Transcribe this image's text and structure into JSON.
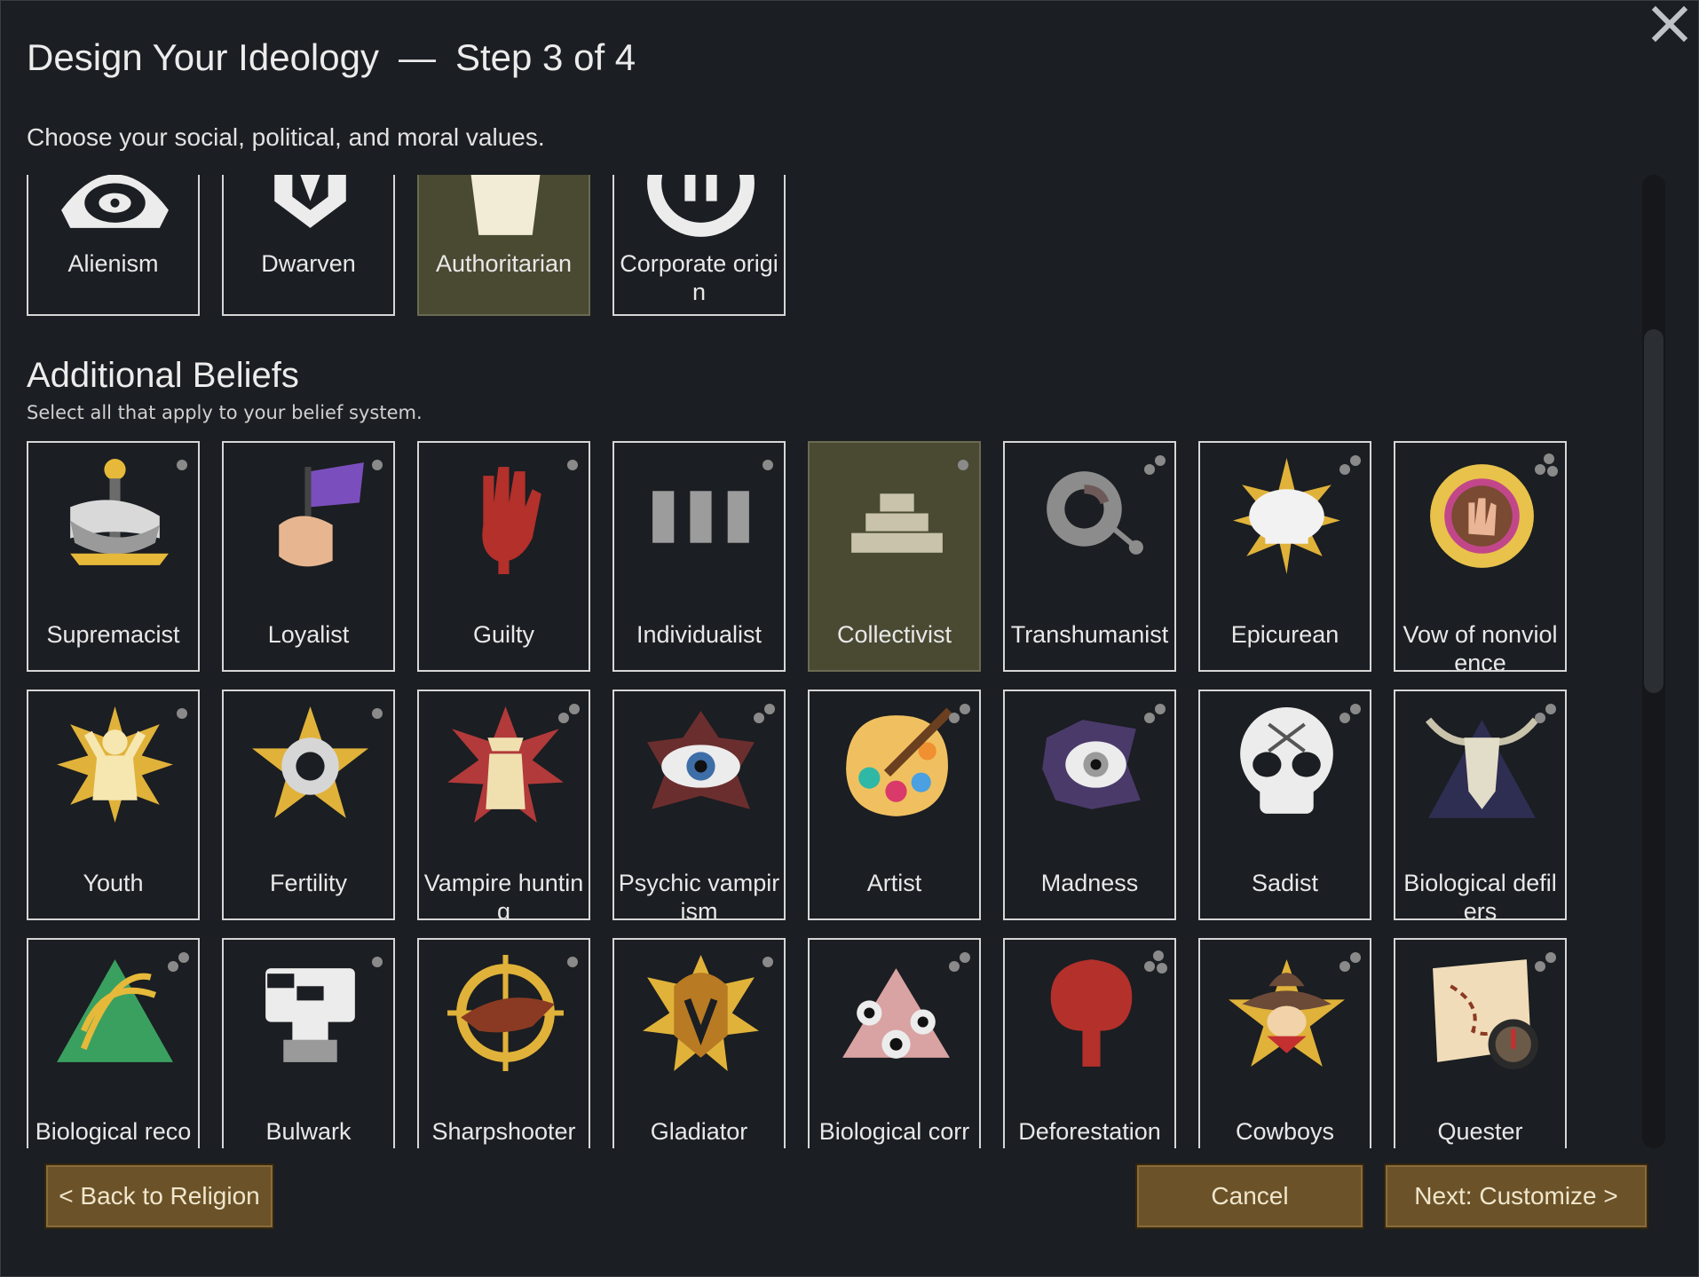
{
  "header": {
    "title": "Design Your Ideology",
    "separator": "—",
    "step": "Step 3 of 4",
    "subtitle": "Choose your social, political, and moral values."
  },
  "top_row": [
    {
      "label": "Alienism",
      "icon": "eye-icon",
      "selected": false
    },
    {
      "label": "Dwarven",
      "icon": "helmet-icon",
      "selected": false
    },
    {
      "label": "Authoritarian",
      "icon": "throne-icon",
      "selected": true
    },
    {
      "label": "Corporate origin",
      "icon": "corporate-icon",
      "selected": false
    }
  ],
  "section": {
    "title": "Additional Beliefs",
    "subtitle": "Select all that apply to your belief system."
  },
  "beliefs": [
    {
      "label": "Supremacist",
      "icon": "supremacist-icon",
      "dots": 1,
      "selected": false
    },
    {
      "label": "Loyalist",
      "icon": "flag-fist-icon",
      "dots": 1,
      "selected": false
    },
    {
      "label": "Guilty",
      "icon": "bloody-hand-icon",
      "dots": 1,
      "selected": false
    },
    {
      "label": "Individualist",
      "icon": "pillars-icon",
      "dots": 1,
      "selected": false
    },
    {
      "label": "Collectivist",
      "icon": "pyramid-icon",
      "dots": 1,
      "selected": true
    },
    {
      "label": "Transhumanist",
      "icon": "gear-circuit-icon",
      "dots": 2,
      "selected": false
    },
    {
      "label": "Epicurean",
      "icon": "chef-hat-icon",
      "dots": 2,
      "selected": false
    },
    {
      "label": "Vow of nonviolence",
      "icon": "sun-hand-icon",
      "dots": 3,
      "selected": false
    },
    {
      "label": "Youth",
      "icon": "youth-icon",
      "dots": 1,
      "selected": false
    },
    {
      "label": "Fertility",
      "icon": "fertility-star-icon",
      "dots": 1,
      "selected": false
    },
    {
      "label": "Vampire hunting",
      "icon": "hunter-icon",
      "dots": 2,
      "selected": false
    },
    {
      "label": "Psychic vampirism",
      "icon": "psychic-eye-icon",
      "dots": 2,
      "selected": false
    },
    {
      "label": "Artist",
      "icon": "palette-icon",
      "dots": 2,
      "selected": false
    },
    {
      "label": "Madness",
      "icon": "madness-eye-icon",
      "dots": 2,
      "selected": false
    },
    {
      "label": "Sadist",
      "icon": "skull-icon",
      "dots": 2,
      "selected": false
    },
    {
      "label": "Biological defilers",
      "icon": "ox-skull-icon",
      "dots": 2,
      "selected": false
    },
    {
      "label": "Biological reconstructor",
      "icon": "dna-icon",
      "dots": 2,
      "selected": false
    },
    {
      "label": "Bulwark",
      "icon": "mech-icon",
      "dots": 1,
      "selected": false
    },
    {
      "label": "Sharpshooter",
      "icon": "crosshair-eagle-icon",
      "dots": 1,
      "selected": false
    },
    {
      "label": "Gladiator",
      "icon": "gladiator-helmet-icon",
      "dots": 1,
      "selected": false
    },
    {
      "label": "Biological corruptors",
      "icon": "tentacle-eyes-icon",
      "dots": 2,
      "selected": false
    },
    {
      "label": "Deforestation",
      "icon": "dead-tree-icon",
      "dots": 3,
      "selected": false
    },
    {
      "label": "Cowboys",
      "icon": "cowboy-hat-icon",
      "dots": 2,
      "selected": false
    },
    {
      "label": "Quester",
      "icon": "map-compass-icon",
      "dots": 2,
      "selected": false
    }
  ],
  "buttons": {
    "back": "< Back to Religion",
    "cancel": "Cancel",
    "next": "Next: Customize >"
  }
}
